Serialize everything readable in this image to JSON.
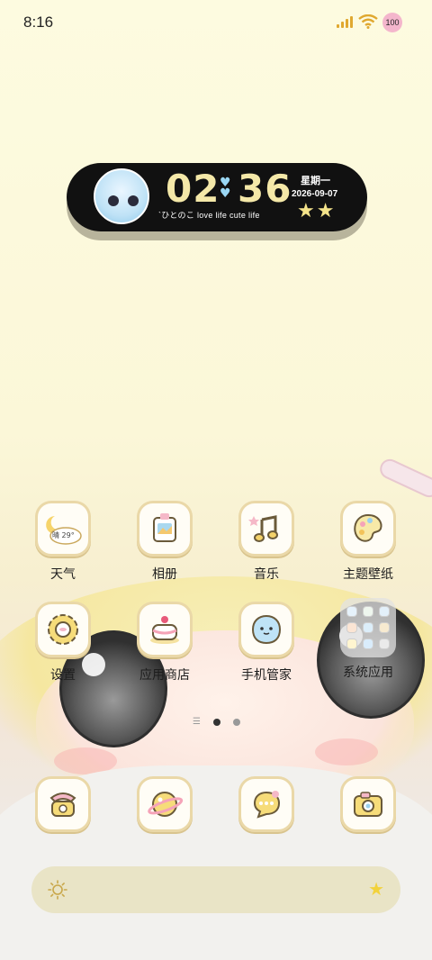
{
  "status": {
    "time": "8:16",
    "battery": "100"
  },
  "clock": {
    "hours": "02",
    "minutes": "36",
    "weekday": "星期一",
    "date": "2026-09-07",
    "slogan": "`ひとのこ love life cute life"
  },
  "apps": [
    {
      "label": "天气",
      "icon": "weather-icon",
      "badge": "晴 29°"
    },
    {
      "label": "相册",
      "icon": "gallery-icon"
    },
    {
      "label": "音乐",
      "icon": "music-icon"
    },
    {
      "label": "主题壁纸",
      "icon": "theme-palette-icon"
    },
    {
      "label": "设置",
      "icon": "settings-gear-icon"
    },
    {
      "label": "应用商店",
      "icon": "app-store-cake-icon"
    },
    {
      "label": "手机管家",
      "icon": "phone-manager-icon"
    },
    {
      "label": "系统应用",
      "icon": "system-apps-folder-icon"
    }
  ],
  "dock": [
    {
      "icon": "phone-icon"
    },
    {
      "icon": "browser-planet-icon"
    },
    {
      "icon": "messages-bubble-icon"
    },
    {
      "icon": "camera-icon"
    }
  ],
  "pager": {
    "pages": 2,
    "current": 1
  },
  "search": {
    "left_icon": "sun-icon",
    "right_icon": "star-icon"
  },
  "colors": {
    "accent": "#f4e8a8",
    "clock_bg": "#111111",
    "icon_border": "#ead8a8"
  }
}
